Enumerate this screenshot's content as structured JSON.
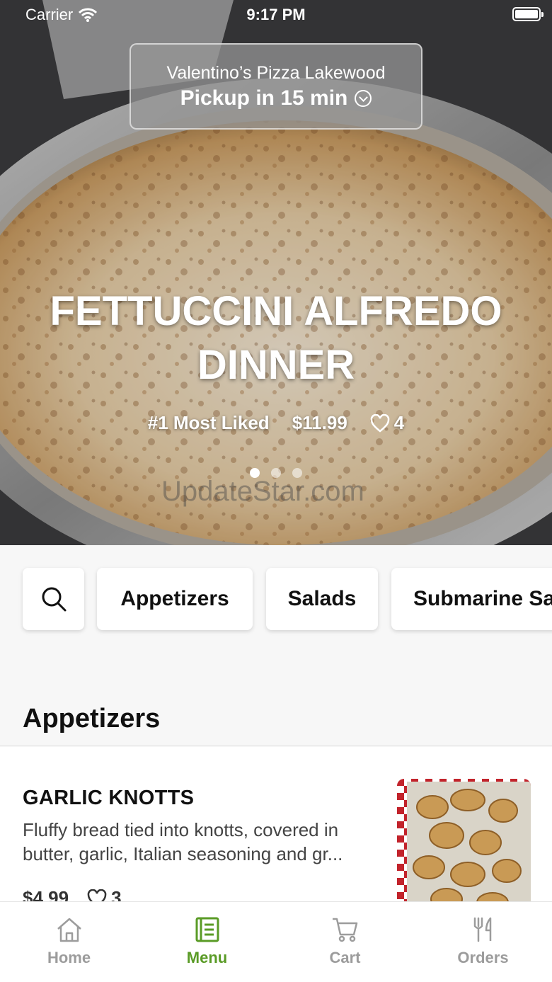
{
  "status_bar": {
    "carrier": "Carrier",
    "time": "9:17 PM"
  },
  "store": {
    "name": "Valentino’s Pizza Lakewood",
    "pickup": "Pickup in 15 min"
  },
  "featured": {
    "title_line1": "FETTUCCINI ALFREDO",
    "title_line2": "DINNER",
    "rank": "#1 Most Liked",
    "price": "$11.99",
    "likes": "4",
    "carousel_pages": 3,
    "carousel_active": 0
  },
  "watermark": "UpdateStar.com",
  "categories": [
    "Appetizers",
    "Salads",
    "Submarine Sandwiches"
  ],
  "section": {
    "title": "Appetizers"
  },
  "items": [
    {
      "name": "GARLIC KNOTTS",
      "description": "Fluffy bread tied into knotts, covered in butter, garlic, Italian seasoning and gr...",
      "price": "$4.99",
      "likes": "3"
    }
  ],
  "tabs": [
    {
      "label": "Home",
      "icon": "home-icon"
    },
    {
      "label": "Menu",
      "icon": "menu-icon"
    },
    {
      "label": "Cart",
      "icon": "cart-icon"
    },
    {
      "label": "Orders",
      "icon": "fork-knife-icon"
    }
  ],
  "colors": {
    "accent": "#5a9b26",
    "tab_inactive": "#9c9c9c"
  }
}
